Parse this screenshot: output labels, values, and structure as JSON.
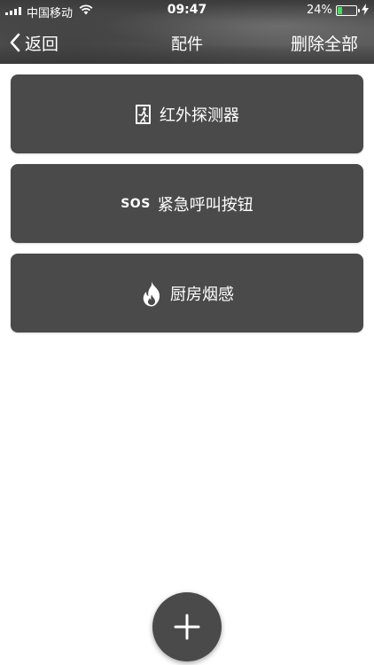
{
  "status_bar": {
    "carrier": "中国移动",
    "time": "09:47",
    "battery_percent": "24%",
    "battery_level": 0.24,
    "icons": [
      "signal-icon",
      "wifi-icon",
      "battery-icon",
      "charging-icon"
    ]
  },
  "nav": {
    "back_label": "返回",
    "title": "配件",
    "delete_all_label": "删除全部"
  },
  "accessories": [
    {
      "label": "红外探测器",
      "icon": "exit-door-icon"
    },
    {
      "label": "紧急呼叫按钮",
      "icon_text": "SOS",
      "icon": "sos-icon"
    },
    {
      "label": "厨房烟感",
      "icon": "fire-icon"
    }
  ],
  "fab": {
    "icon": "plus-icon"
  },
  "colors": {
    "item_background": "#4a4a4a",
    "text": "#ffffff",
    "battery_fill": "#4cd964"
  }
}
